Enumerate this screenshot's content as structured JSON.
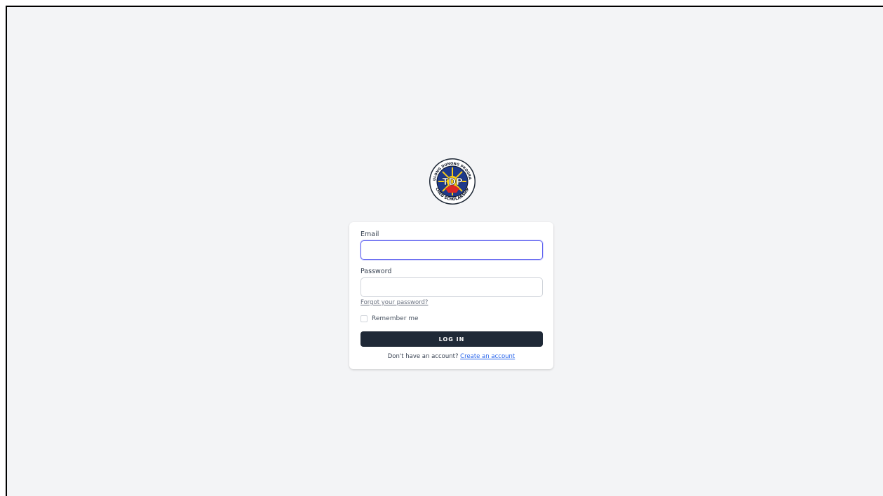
{
  "logo": {
    "alt_text": "TULONG DUNONG PROGRAM CHED SCHOLARSHIP",
    "ring_top_text": "TULONG DUNONG PROGRAM",
    "ring_bottom_text": "CHED SCHOLARSHIP",
    "center_text": "TDP",
    "colors": {
      "ring": "#ffffff",
      "inner": "#1e3a8a",
      "sun": "#facc15",
      "red": "#dc2626"
    }
  },
  "form": {
    "email_label": "Email",
    "email_value": "",
    "password_label": "Password",
    "password_value": "",
    "forgot_password": "Forgot your password?",
    "remember_label": "Remember me",
    "remember_checked": false,
    "login_button": "LOG IN",
    "signup_prompt": "Don't have an account?",
    "signup_link": "Create an account"
  },
  "colors": {
    "background": "#f3f4f6",
    "button": "#1f2937",
    "focus": "#6366f1",
    "link": "#2563eb"
  }
}
